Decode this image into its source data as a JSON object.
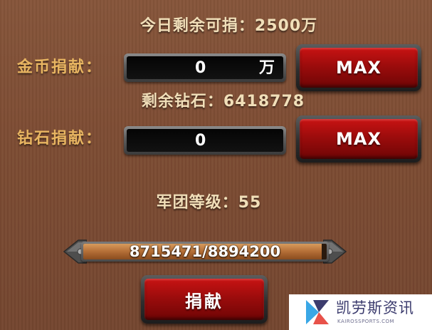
{
  "daily_donation": {
    "label": "今日剩余可捐：",
    "value": "2500万"
  },
  "gold_donation": {
    "label": "金币捐献：",
    "input_value": "0",
    "unit": "万",
    "max_label": "MAX"
  },
  "remaining_diamonds": {
    "label": "剩余钻石：",
    "value": "6418778"
  },
  "diamond_donation": {
    "label": "钻石捐献：",
    "input_value": "0",
    "max_label": "MAX"
  },
  "legion_level": {
    "label": "军团等级：",
    "value": "55"
  },
  "progress": {
    "current": 8715471,
    "total": 8894200,
    "text": "8715471/8894200"
  },
  "donate_button": {
    "label": "捐献"
  },
  "watermark": {
    "title": "凯劳斯资讯",
    "subtitle": "KAIROSSPORTS.COM"
  },
  "colors": {
    "background": "#7c4c33",
    "label_gold": "#e8b561",
    "text_cream": "#f1dfb9",
    "button_red": "#9c0c0c",
    "bar_fill": "#b46e36"
  }
}
